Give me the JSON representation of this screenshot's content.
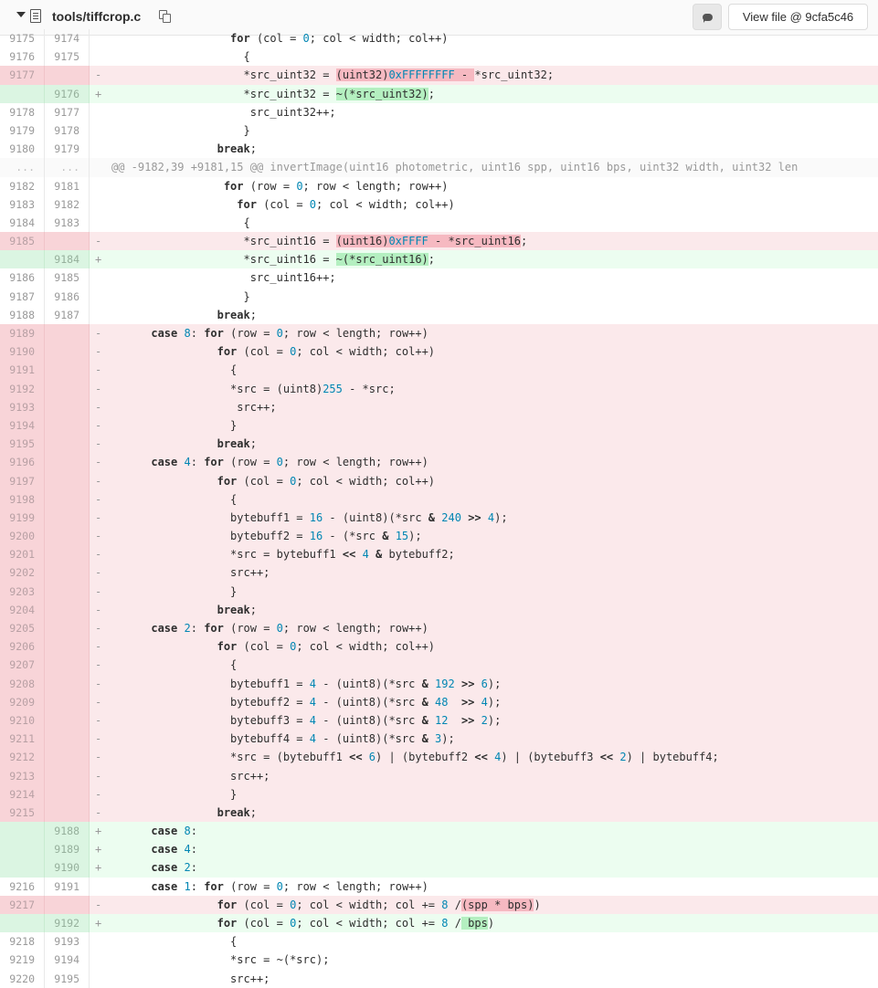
{
  "header": {
    "file_path": "tools/tiffcrop.c",
    "view_file_label": "View file @ 9cfa5c46"
  },
  "colors": {
    "removed_row": "#fbe9eb",
    "added_row": "#ecfdf0",
    "removed_highlight": "#f6b9c1",
    "added_highlight": "#b4efc0",
    "number": "#0086b3"
  },
  "lines": [
    {
      "type": "ctx",
      "old": "9175",
      "new": "9174",
      "code": [
        [
          "t",
          "                  "
        ],
        [
          "kw",
          "for"
        ],
        [
          "t",
          " (col = "
        ],
        [
          "num",
          "0"
        ],
        [
          "t",
          "; col < width; col++)"
        ]
      ]
    },
    {
      "type": "ctx",
      "old": "9176",
      "new": "9175",
      "code": [
        [
          "t",
          "                    {"
        ]
      ]
    },
    {
      "type": "del",
      "old": "9177",
      "new": "",
      "code": [
        [
          "t",
          "                    *src_uint32 = "
        ],
        [
          "hd",
          "(uint32)"
        ],
        [
          "hdn",
          "0xFFFFFFFF"
        ],
        [
          "hd",
          " - "
        ],
        [
          "t",
          "*src_uint32;"
        ]
      ]
    },
    {
      "type": "add",
      "old": "",
      "new": "9176",
      "code": [
        [
          "t",
          "                    *src_uint32 = "
        ],
        [
          "ha",
          "~(*src_uint32)"
        ],
        [
          "t",
          ";"
        ]
      ]
    },
    {
      "type": "ctx",
      "old": "9178",
      "new": "9177",
      "code": [
        [
          "t",
          "                     src_uint32++;"
        ]
      ]
    },
    {
      "type": "ctx",
      "old": "9179",
      "new": "9178",
      "code": [
        [
          "t",
          "                    }"
        ]
      ]
    },
    {
      "type": "ctx",
      "old": "9180",
      "new": "9179",
      "code": [
        [
          "t",
          "                "
        ],
        [
          "kw",
          "break"
        ],
        [
          "t",
          ";"
        ]
      ]
    },
    {
      "type": "hunk",
      "old": "...",
      "new": "...",
      "code": [
        [
          "t",
          "@@ -9182,39 +9181,15 @@ invertImage(uint16 photometric, uint16 spp, uint16 bps, uint32 width, uint32 len"
        ]
      ]
    },
    {
      "type": "ctx",
      "old": "9182",
      "new": "9181",
      "code": [
        [
          "t",
          "                 "
        ],
        [
          "kw",
          "for"
        ],
        [
          "t",
          " (row = "
        ],
        [
          "num",
          "0"
        ],
        [
          "t",
          "; row < length; row++)"
        ]
      ]
    },
    {
      "type": "ctx",
      "old": "9183",
      "new": "9182",
      "code": [
        [
          "t",
          "                   "
        ],
        [
          "kw",
          "for"
        ],
        [
          "t",
          " (col = "
        ],
        [
          "num",
          "0"
        ],
        [
          "t",
          "; col < width; col++)"
        ]
      ]
    },
    {
      "type": "ctx",
      "old": "9184",
      "new": "9183",
      "code": [
        [
          "t",
          "                    {"
        ]
      ]
    },
    {
      "type": "del",
      "old": "9185",
      "new": "",
      "code": [
        [
          "t",
          "                    *src_uint16 = "
        ],
        [
          "hd",
          "(uint16)"
        ],
        [
          "hdn",
          "0xFFFF"
        ],
        [
          "hd",
          " - *src_uint16"
        ],
        [
          "t",
          ";"
        ]
      ]
    },
    {
      "type": "add",
      "old": "",
      "new": "9184",
      "code": [
        [
          "t",
          "                    *src_uint16 = "
        ],
        [
          "ha",
          "~(*src_uint16)"
        ],
        [
          "t",
          ";"
        ]
      ]
    },
    {
      "type": "ctx",
      "old": "9186",
      "new": "9185",
      "code": [
        [
          "t",
          "                     src_uint16++;"
        ]
      ]
    },
    {
      "type": "ctx",
      "old": "9187",
      "new": "9186",
      "code": [
        [
          "t",
          "                    }"
        ]
      ]
    },
    {
      "type": "ctx",
      "old": "9188",
      "new": "9187",
      "code": [
        [
          "t",
          "                "
        ],
        [
          "kw",
          "break"
        ],
        [
          "t",
          ";"
        ]
      ]
    },
    {
      "type": "del",
      "old": "9189",
      "new": "",
      "code": [
        [
          "t",
          "      "
        ],
        [
          "kw",
          "case"
        ],
        [
          "t",
          " "
        ],
        [
          "num",
          "8"
        ],
        [
          "t",
          ": "
        ],
        [
          "kw",
          "for"
        ],
        [
          "t",
          " (row = "
        ],
        [
          "num",
          "0"
        ],
        [
          "t",
          "; row < length; row++)"
        ]
      ]
    },
    {
      "type": "del",
      "old": "9190",
      "new": "",
      "code": [
        [
          "t",
          "                "
        ],
        [
          "kw",
          "for"
        ],
        [
          "t",
          " (col = "
        ],
        [
          "num",
          "0"
        ],
        [
          "t",
          "; col < width; col++)"
        ]
      ]
    },
    {
      "type": "del",
      "old": "9191",
      "new": "",
      "code": [
        [
          "t",
          "                  {"
        ]
      ]
    },
    {
      "type": "del",
      "old": "9192",
      "new": "",
      "code": [
        [
          "t",
          "                  *src = (uint8)"
        ],
        [
          "num",
          "255"
        ],
        [
          "t",
          " - *src;"
        ]
      ]
    },
    {
      "type": "del",
      "old": "9193",
      "new": "",
      "code": [
        [
          "t",
          "                   src++;"
        ]
      ]
    },
    {
      "type": "del",
      "old": "9194",
      "new": "",
      "code": [
        [
          "t",
          "                  }"
        ]
      ]
    },
    {
      "type": "del",
      "old": "9195",
      "new": "",
      "code": [
        [
          "t",
          "                "
        ],
        [
          "kw",
          "break"
        ],
        [
          "t",
          ";"
        ]
      ]
    },
    {
      "type": "del",
      "old": "9196",
      "new": "",
      "code": [
        [
          "t",
          "      "
        ],
        [
          "kw",
          "case"
        ],
        [
          "t",
          " "
        ],
        [
          "num",
          "4"
        ],
        [
          "t",
          ": "
        ],
        [
          "kw",
          "for"
        ],
        [
          "t",
          " (row = "
        ],
        [
          "num",
          "0"
        ],
        [
          "t",
          "; row < length; row++)"
        ]
      ]
    },
    {
      "type": "del",
      "old": "9197",
      "new": "",
      "code": [
        [
          "t",
          "                "
        ],
        [
          "kw",
          "for"
        ],
        [
          "t",
          " (col = "
        ],
        [
          "num",
          "0"
        ],
        [
          "t",
          "; col < width; col++)"
        ]
      ]
    },
    {
      "type": "del",
      "old": "9198",
      "new": "",
      "code": [
        [
          "t",
          "                  {"
        ]
      ]
    },
    {
      "type": "del",
      "old": "9199",
      "new": "",
      "code": [
        [
          "t",
          "                  bytebuff1 = "
        ],
        [
          "num",
          "16"
        ],
        [
          "t",
          " - (uint8)(*src "
        ],
        [
          "kw",
          "&"
        ],
        [
          "t",
          " "
        ],
        [
          "num",
          "240"
        ],
        [
          "t",
          " "
        ],
        [
          "kw",
          ">>"
        ],
        [
          "t",
          " "
        ],
        [
          "num",
          "4"
        ],
        [
          "t",
          ");"
        ]
      ]
    },
    {
      "type": "del",
      "old": "9200",
      "new": "",
      "code": [
        [
          "t",
          "                  bytebuff2 = "
        ],
        [
          "num",
          "16"
        ],
        [
          "t",
          " - (*src "
        ],
        [
          "kw",
          "&"
        ],
        [
          "t",
          " "
        ],
        [
          "num",
          "15"
        ],
        [
          "t",
          ");"
        ]
      ]
    },
    {
      "type": "del",
      "old": "9201",
      "new": "",
      "code": [
        [
          "t",
          "                  *src = bytebuff1 "
        ],
        [
          "kw",
          "<<"
        ],
        [
          "t",
          " "
        ],
        [
          "num",
          "4"
        ],
        [
          "t",
          " "
        ],
        [
          "kw",
          "&"
        ],
        [
          "t",
          " bytebuff2;"
        ]
      ]
    },
    {
      "type": "del",
      "old": "9202",
      "new": "",
      "code": [
        [
          "t",
          "                  src++;"
        ]
      ]
    },
    {
      "type": "del",
      "old": "9203",
      "new": "",
      "code": [
        [
          "t",
          "                  }"
        ]
      ]
    },
    {
      "type": "del",
      "old": "9204",
      "new": "",
      "code": [
        [
          "t",
          "                "
        ],
        [
          "kw",
          "break"
        ],
        [
          "t",
          ";"
        ]
      ]
    },
    {
      "type": "del",
      "old": "9205",
      "new": "",
      "code": [
        [
          "t",
          "      "
        ],
        [
          "kw",
          "case"
        ],
        [
          "t",
          " "
        ],
        [
          "num",
          "2"
        ],
        [
          "t",
          ": "
        ],
        [
          "kw",
          "for"
        ],
        [
          "t",
          " (row = "
        ],
        [
          "num",
          "0"
        ],
        [
          "t",
          "; row < length; row++)"
        ]
      ]
    },
    {
      "type": "del",
      "old": "9206",
      "new": "",
      "code": [
        [
          "t",
          "                "
        ],
        [
          "kw",
          "for"
        ],
        [
          "t",
          " (col = "
        ],
        [
          "num",
          "0"
        ],
        [
          "t",
          "; col < width; col++)"
        ]
      ]
    },
    {
      "type": "del",
      "old": "9207",
      "new": "",
      "code": [
        [
          "t",
          "                  {"
        ]
      ]
    },
    {
      "type": "del",
      "old": "9208",
      "new": "",
      "code": [
        [
          "t",
          "                  bytebuff1 = "
        ],
        [
          "num",
          "4"
        ],
        [
          "t",
          " - (uint8)(*src "
        ],
        [
          "kw",
          "&"
        ],
        [
          "t",
          " "
        ],
        [
          "num",
          "192"
        ],
        [
          "t",
          " "
        ],
        [
          "kw",
          ">>"
        ],
        [
          "t",
          " "
        ],
        [
          "num",
          "6"
        ],
        [
          "t",
          ");"
        ]
      ]
    },
    {
      "type": "del",
      "old": "9209",
      "new": "",
      "code": [
        [
          "t",
          "                  bytebuff2 = "
        ],
        [
          "num",
          "4"
        ],
        [
          "t",
          " - (uint8)(*src "
        ],
        [
          "kw",
          "&"
        ],
        [
          "t",
          " "
        ],
        [
          "num",
          "48"
        ],
        [
          "t",
          "  "
        ],
        [
          "kw",
          ">>"
        ],
        [
          "t",
          " "
        ],
        [
          "num",
          "4"
        ],
        [
          "t",
          ");"
        ]
      ]
    },
    {
      "type": "del",
      "old": "9210",
      "new": "",
      "code": [
        [
          "t",
          "                  bytebuff3 = "
        ],
        [
          "num",
          "4"
        ],
        [
          "t",
          " - (uint8)(*src "
        ],
        [
          "kw",
          "&"
        ],
        [
          "t",
          " "
        ],
        [
          "num",
          "12"
        ],
        [
          "t",
          "  "
        ],
        [
          "kw",
          ">>"
        ],
        [
          "t",
          " "
        ],
        [
          "num",
          "2"
        ],
        [
          "t",
          ");"
        ]
      ]
    },
    {
      "type": "del",
      "old": "9211",
      "new": "",
      "code": [
        [
          "t",
          "                  bytebuff4 = "
        ],
        [
          "num",
          "4"
        ],
        [
          "t",
          " - (uint8)(*src "
        ],
        [
          "kw",
          "&"
        ],
        [
          "t",
          " "
        ],
        [
          "num",
          "3"
        ],
        [
          "t",
          ");"
        ]
      ]
    },
    {
      "type": "del",
      "old": "9212",
      "new": "",
      "code": [
        [
          "t",
          "                  *src = (bytebuff1 "
        ],
        [
          "kw",
          "<<"
        ],
        [
          "t",
          " "
        ],
        [
          "num",
          "6"
        ],
        [
          "t",
          ") | (bytebuff2 "
        ],
        [
          "kw",
          "<<"
        ],
        [
          "t",
          " "
        ],
        [
          "num",
          "4"
        ],
        [
          "t",
          ") | (bytebuff3 "
        ],
        [
          "kw",
          "<<"
        ],
        [
          "t",
          " "
        ],
        [
          "num",
          "2"
        ],
        [
          "t",
          ") | bytebuff4;"
        ]
      ]
    },
    {
      "type": "del",
      "old": "9213",
      "new": "",
      "code": [
        [
          "t",
          "                  src++;"
        ]
      ]
    },
    {
      "type": "del",
      "old": "9214",
      "new": "",
      "code": [
        [
          "t",
          "                  }"
        ]
      ]
    },
    {
      "type": "del",
      "old": "9215",
      "new": "",
      "code": [
        [
          "t",
          "                "
        ],
        [
          "kw",
          "break"
        ],
        [
          "t",
          ";"
        ]
      ]
    },
    {
      "type": "add",
      "old": "",
      "new": "9188",
      "code": [
        [
          "t",
          "      "
        ],
        [
          "kw",
          "case"
        ],
        [
          "t",
          " "
        ],
        [
          "num",
          "8"
        ],
        [
          "t",
          ":"
        ]
      ]
    },
    {
      "type": "add",
      "old": "",
      "new": "9189",
      "code": [
        [
          "t",
          "      "
        ],
        [
          "kw",
          "case"
        ],
        [
          "t",
          " "
        ],
        [
          "num",
          "4"
        ],
        [
          "t",
          ":"
        ]
      ]
    },
    {
      "type": "add",
      "old": "",
      "new": "9190",
      "code": [
        [
          "t",
          "      "
        ],
        [
          "kw",
          "case"
        ],
        [
          "t",
          " "
        ],
        [
          "num",
          "2"
        ],
        [
          "t",
          ":"
        ]
      ]
    },
    {
      "type": "ctx",
      "old": "9216",
      "new": "9191",
      "code": [
        [
          "t",
          "      "
        ],
        [
          "kw",
          "case"
        ],
        [
          "t",
          " "
        ],
        [
          "num",
          "1"
        ],
        [
          "t",
          ": "
        ],
        [
          "kw",
          "for"
        ],
        [
          "t",
          " (row = "
        ],
        [
          "num",
          "0"
        ],
        [
          "t",
          "; row < length; row++)"
        ]
      ]
    },
    {
      "type": "del",
      "old": "9217",
      "new": "",
      "code": [
        [
          "t",
          "                "
        ],
        [
          "kw",
          "for"
        ],
        [
          "t",
          " (col = "
        ],
        [
          "num",
          "0"
        ],
        [
          "t",
          "; col < width; col += "
        ],
        [
          "num",
          "8"
        ],
        [
          "t",
          " /"
        ],
        [
          "hd",
          "(spp * bps)"
        ],
        [
          "t",
          ")"
        ]
      ]
    },
    {
      "type": "add",
      "old": "",
      "new": "9192",
      "code": [
        [
          "t",
          "                "
        ],
        [
          "kw",
          "for"
        ],
        [
          "t",
          " (col = "
        ],
        [
          "num",
          "0"
        ],
        [
          "t",
          "; col < width; col += "
        ],
        [
          "num",
          "8"
        ],
        [
          "t",
          " /"
        ],
        [
          "ha",
          " bps"
        ],
        [
          "t",
          ")"
        ]
      ]
    },
    {
      "type": "ctx",
      "old": "9218",
      "new": "9193",
      "code": [
        [
          "t",
          "                  {"
        ]
      ]
    },
    {
      "type": "ctx",
      "old": "9219",
      "new": "9194",
      "code": [
        [
          "t",
          "                  *src = ~(*src);"
        ]
      ]
    },
    {
      "type": "ctx",
      "old": "9220",
      "new": "9195",
      "code": [
        [
          "t",
          "                  src++;"
        ]
      ]
    }
  ]
}
